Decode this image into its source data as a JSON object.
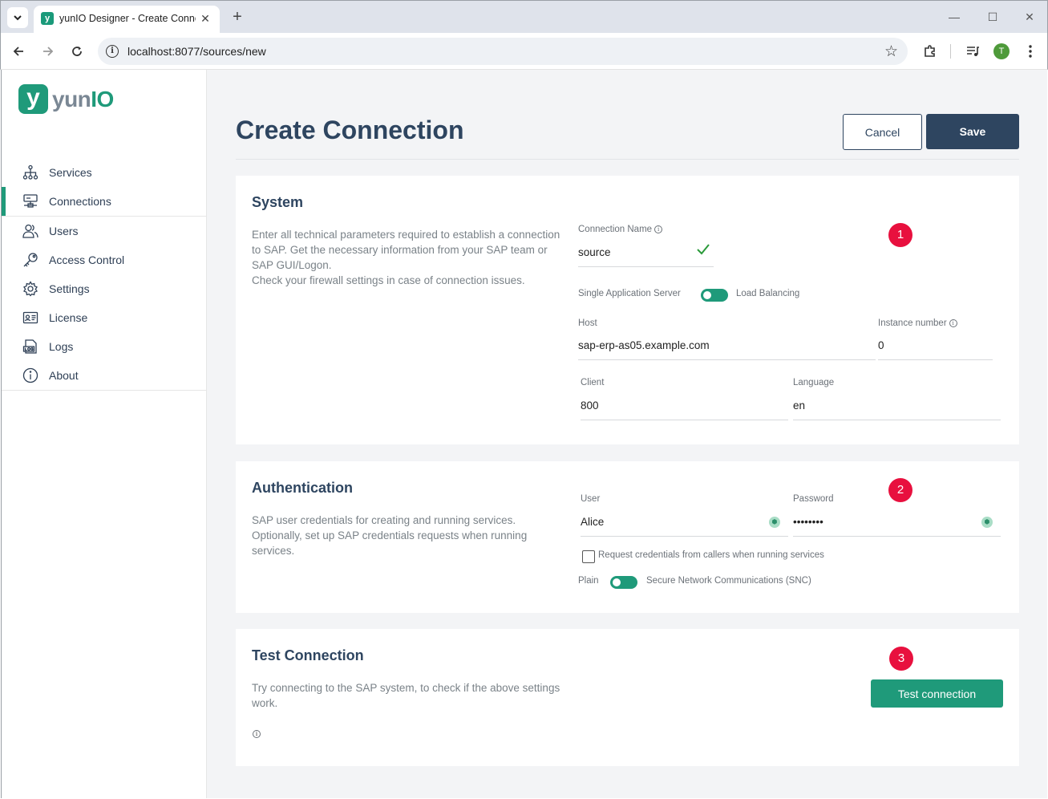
{
  "browser": {
    "tab_title": "yunIO Designer - Create Conne",
    "url": "localhost:8077/sources/new",
    "profile_initial": "T"
  },
  "logo": {
    "mark": "y",
    "text_a": "yun",
    "text_b": "IO"
  },
  "sidebar": {
    "items": [
      {
        "label": "Services",
        "icon": "services-tree-icon"
      },
      {
        "label": "Connections",
        "icon": "connections-icon",
        "active": true
      },
      {
        "label": "Users",
        "icon": "users-icon"
      },
      {
        "label": "Access Control",
        "icon": "key-icon"
      },
      {
        "label": "Settings",
        "icon": "gear-icon"
      },
      {
        "label": "License",
        "icon": "license-card-icon"
      },
      {
        "label": "Logs",
        "icon": "logs-icon"
      },
      {
        "label": "About",
        "icon": "info-icon"
      }
    ]
  },
  "page": {
    "title": "Create Connection",
    "cancel_label": "Cancel",
    "save_label": "Save"
  },
  "system": {
    "heading": "System",
    "desc_1": "Enter all technical parameters required to establish a connection to SAP. Get the necessary information from your SAP team or SAP GUI/Logon.",
    "desc_2": "Check your firewall settings in case of connection issues.",
    "badge": "1",
    "connection_name_label": "Connection Name",
    "connection_name_value": "source",
    "toggle_left": "Single Application Server",
    "toggle_right": "Load Balancing",
    "host_label": "Host",
    "host_value": "sap-erp-as05.example.com",
    "instance_label": "Instance number",
    "instance_value": "0",
    "client_label": "Client",
    "client_value": "800",
    "language_label": "Language",
    "language_value": "en"
  },
  "auth": {
    "heading": "Authentication",
    "desc": "SAP user credentials for creating and running services. Optionally, set up SAP credentials requests when running services.",
    "badge": "2",
    "user_label": "User",
    "user_value": "Alice",
    "password_label": "Password",
    "password_value": "••••••••",
    "request_label": "Request credentials from callers when running services",
    "toggle_left": "Plain",
    "toggle_right": "Secure Network Communications (SNC)"
  },
  "test": {
    "heading": "Test Connection",
    "desc": "Try connecting to the SAP system, to check if the above settings work.",
    "badge": "3",
    "button_label": "Test connection"
  },
  "colors": {
    "accent": "#1f9a7a",
    "navy": "#2e4560",
    "badge": "#e8103e"
  }
}
